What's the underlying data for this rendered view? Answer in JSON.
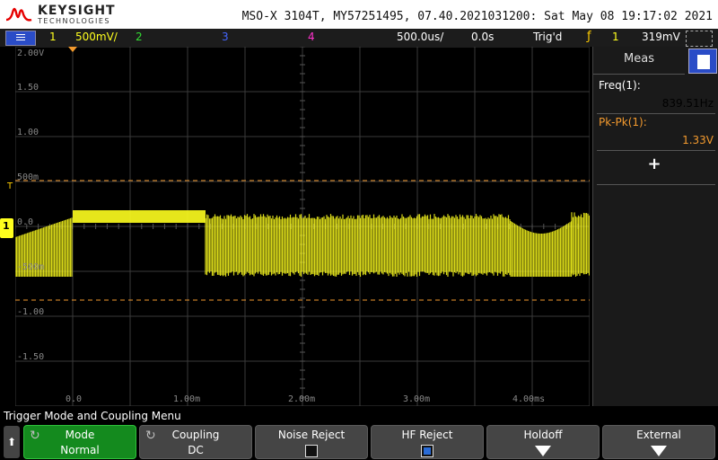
{
  "header": {
    "brand": "KEYSIGHT",
    "brand_sub": "TECHNOLOGIES",
    "model_info": "MSO-X 3104T, MY57251495, 07.40.2021031200: Sat May 08 19:17:02 2021"
  },
  "status_bar": {
    "ch1_num": "1",
    "ch1_scale": "500mV/",
    "ch2_num": "2",
    "ch3_num": "3",
    "ch4_num": "4",
    "timebase": "500.0us/",
    "delay": "0.0s",
    "trigger_state": "Trig'd",
    "trigger_channel": "1",
    "trigger_level": "319mV"
  },
  "graticule": {
    "y_labels": [
      "2.00V",
      "1.50",
      "1.00",
      "500m",
      "0.0",
      "-500m",
      "-1.00",
      "-1.50"
    ],
    "x_labels": [
      "0.0",
      "1.00m",
      "2.00m",
      "3.00m",
      "4.00ms"
    ],
    "trigger_marker": "T",
    "ch1_marker": "1"
  },
  "measurements": {
    "tab_label": "Meas",
    "items": [
      {
        "label": "Freq(1):",
        "value": "839.51Hz",
        "label_color": "#ffffff",
        "value_color": "#ffffff"
      },
      {
        "label": "Pk-Pk(1):",
        "value": "1.33V",
        "label_color": "#f39a2e",
        "value_color": "#f39a2e"
      }
    ],
    "add_symbol": "+"
  },
  "menu": {
    "title": "Trigger Mode and Coupling Menu",
    "back_symbol": "⬆",
    "softkeys": [
      {
        "label": "Mode",
        "value": "Normal",
        "kind": "value",
        "active": true
      },
      {
        "label": "Coupling",
        "value": "DC",
        "kind": "value",
        "active": false
      },
      {
        "label": "Noise Reject",
        "kind": "checkbox",
        "checked": false
      },
      {
        "label": "HF Reject",
        "kind": "checkbox",
        "checked": true
      },
      {
        "label": "Holdoff",
        "kind": "arrow"
      },
      {
        "label": "External",
        "kind": "arrow"
      }
    ]
  },
  "colors": {
    "ch1": "#ffff1e",
    "ch2": "#33dd33",
    "ch3": "#4466ff",
    "ch4": "#ff33cc",
    "cursor": "#f39a2e",
    "measurement_accent": "#f39a2e"
  }
}
